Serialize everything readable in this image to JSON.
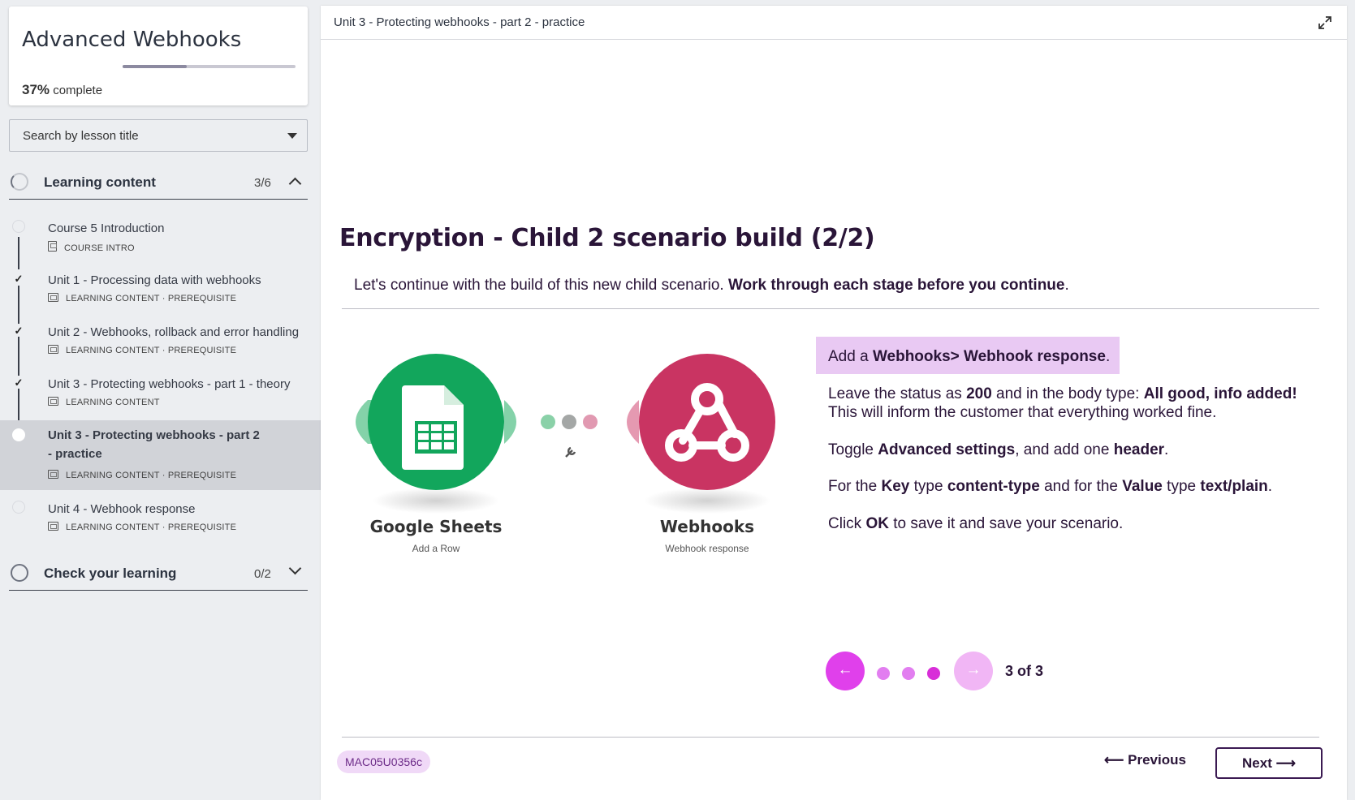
{
  "course": {
    "title": "Advanced Webhooks",
    "progress_percent": "37%",
    "progress_fraction": 0.37,
    "progress_label": " complete"
  },
  "search": {
    "placeholder": "Search by lesson title"
  },
  "sections": [
    {
      "title": "Learning content",
      "count": "3/6",
      "lessons": [
        {
          "title": "Course 5 Introduction",
          "meta": "COURSE INTRO",
          "status": "not-started"
        },
        {
          "title": "Unit 1 - Processing data with webhooks",
          "meta": "LEARNING CONTENT · PREREQUISITE",
          "status": "done"
        },
        {
          "title": "Unit 2 - Webhooks, rollback and error handling",
          "meta": "LEARNING CONTENT · PREREQUISITE",
          "status": "done"
        },
        {
          "title": "Unit 3 - Protecting webhooks - part 1 - theory",
          "meta": "LEARNING CONTENT",
          "status": "done"
        },
        {
          "title": "Unit 3 - Protecting webhooks - part 2 - practice",
          "meta": "LEARNING CONTENT · PREREQUISITE",
          "status": "current"
        },
        {
          "title": "Unit 4 - Webhook response",
          "meta": "LEARNING CONTENT · PREREQUISITE",
          "status": "not-started"
        }
      ]
    },
    {
      "title": "Check your learning",
      "count": "0/2"
    }
  ],
  "main": {
    "header_title": "Unit 3 - Protecting webhooks - part 2 - practice",
    "heading": "Encryption - Child 2 scenario build (2/2)",
    "intro_plain": "Let's continue with the build of this new child scenario. ",
    "intro_bold": "Work through each stage before you continue",
    "intro_end": ".",
    "diagram": {
      "left_module": {
        "name": "Google Sheets",
        "action": "Add a Row",
        "color": "#12a65c"
      },
      "right_module": {
        "name": "Webhooks",
        "action": "Webhook response",
        "color": "#c93462"
      }
    },
    "instructions": {
      "box": {
        "t1": "Add a ",
        "b1": "Webhooks> Webhook response",
        "t2": "."
      },
      "p1": {
        "t1": "Leave the status as ",
        "b1": "200",
        "t2": " and in the body type: ",
        "b2": "All good, info added!",
        "t3": "This will inform the customer that everything worked fine."
      },
      "p2": {
        "t1": "Toggle ",
        "b1": "Advanced settings",
        "t2": ", and add one ",
        "b2": "header",
        "t3": "."
      },
      "p3": {
        "t1": "For the ",
        "b1": "Key",
        "t2": " type ",
        "b2": "content-type",
        "t3": " and for the ",
        "b3": "Value",
        "t4": " type ",
        "b4": "text/plain",
        "t5": "."
      },
      "p4": {
        "t1": "Click ",
        "b1": "OK",
        "t2": " to save it and save your scenario."
      }
    },
    "carousel": {
      "prev_icon": "arrow-left-icon",
      "next_icon": "arrow-right-icon",
      "count": "3 of 3"
    },
    "code": "MAC05U0356c",
    "prev_label": "Previous",
    "next_label": "Next"
  },
  "colors": {
    "accent": "#e040eb",
    "heading": "#2a1538",
    "sheets": "#12a65c",
    "webhooks": "#c93462"
  }
}
